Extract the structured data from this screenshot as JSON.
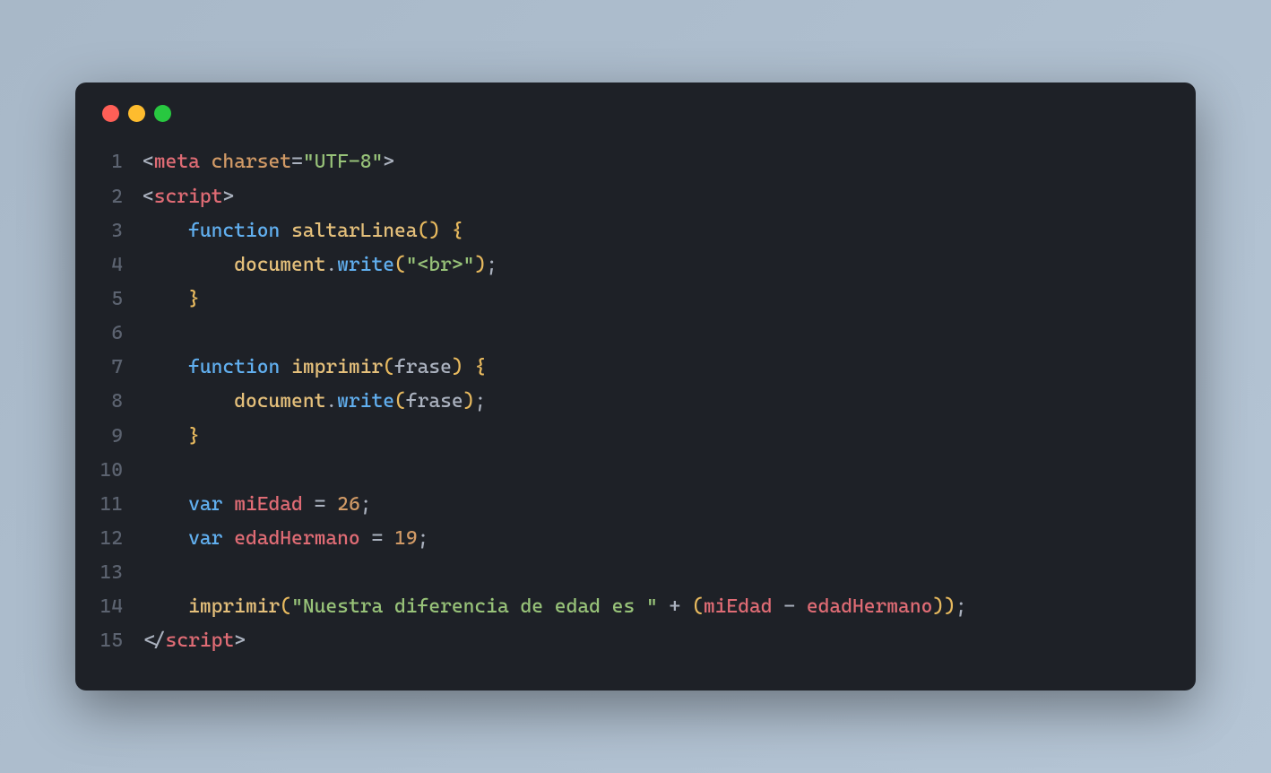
{
  "window": {
    "controls": [
      "close",
      "minimize",
      "maximize"
    ]
  },
  "code": {
    "lines": [
      {
        "num": "1",
        "indent": "",
        "tokens": [
          {
            "cls": "punct",
            "t": "<"
          },
          {
            "cls": "tag",
            "t": "meta"
          },
          {
            "cls": "default",
            "t": " "
          },
          {
            "cls": "attr",
            "t": "charset"
          },
          {
            "cls": "punct",
            "t": "="
          },
          {
            "cls": "string",
            "t": "\"UTF-8\""
          },
          {
            "cls": "punct",
            "t": ">"
          }
        ]
      },
      {
        "num": "2",
        "indent": "",
        "tokens": [
          {
            "cls": "punct",
            "t": "<"
          },
          {
            "cls": "tag",
            "t": "script"
          },
          {
            "cls": "punct",
            "t": ">"
          }
        ]
      },
      {
        "num": "3",
        "indent": "    ",
        "tokens": [
          {
            "cls": "kw-blue",
            "t": "function"
          },
          {
            "cls": "default",
            "t": " "
          },
          {
            "cls": "ident",
            "t": "saltarLinea"
          },
          {
            "cls": "bracket",
            "t": "()"
          },
          {
            "cls": "default",
            "t": " "
          },
          {
            "cls": "bracket",
            "t": "{"
          }
        ]
      },
      {
        "num": "4",
        "indent": "        ",
        "tokens": [
          {
            "cls": "obj",
            "t": "document"
          },
          {
            "cls": "punct",
            "t": "."
          },
          {
            "cls": "func",
            "t": "write"
          },
          {
            "cls": "bracket",
            "t": "("
          },
          {
            "cls": "string",
            "t": "\"<br>\""
          },
          {
            "cls": "bracket",
            "t": ")"
          },
          {
            "cls": "punct",
            "t": ";"
          }
        ]
      },
      {
        "num": "5",
        "indent": "    ",
        "tokens": [
          {
            "cls": "bracket",
            "t": "}"
          }
        ]
      },
      {
        "num": "6",
        "indent": "",
        "tokens": []
      },
      {
        "num": "7",
        "indent": "    ",
        "tokens": [
          {
            "cls": "kw-blue",
            "t": "function"
          },
          {
            "cls": "default",
            "t": " "
          },
          {
            "cls": "ident",
            "t": "imprimir"
          },
          {
            "cls": "bracket",
            "t": "("
          },
          {
            "cls": "param",
            "t": "frase"
          },
          {
            "cls": "bracket",
            "t": ")"
          },
          {
            "cls": "default",
            "t": " "
          },
          {
            "cls": "bracket",
            "t": "{"
          }
        ]
      },
      {
        "num": "8",
        "indent": "        ",
        "tokens": [
          {
            "cls": "obj",
            "t": "document"
          },
          {
            "cls": "punct",
            "t": "."
          },
          {
            "cls": "func",
            "t": "write"
          },
          {
            "cls": "bracket",
            "t": "("
          },
          {
            "cls": "param",
            "t": "frase"
          },
          {
            "cls": "bracket",
            "t": ")"
          },
          {
            "cls": "punct",
            "t": ";"
          }
        ]
      },
      {
        "num": "9",
        "indent": "    ",
        "tokens": [
          {
            "cls": "bracket",
            "t": "}"
          }
        ]
      },
      {
        "num": "10",
        "indent": "",
        "tokens": []
      },
      {
        "num": "11",
        "indent": "    ",
        "tokens": [
          {
            "cls": "kw-blue",
            "t": "var"
          },
          {
            "cls": "default",
            "t": " "
          },
          {
            "cls": "var-name",
            "t": "miEdad"
          },
          {
            "cls": "default",
            "t": " "
          },
          {
            "cls": "punct",
            "t": "="
          },
          {
            "cls": "default",
            "t": " "
          },
          {
            "cls": "number",
            "t": "26"
          },
          {
            "cls": "punct",
            "t": ";"
          }
        ]
      },
      {
        "num": "12",
        "indent": "    ",
        "tokens": [
          {
            "cls": "kw-blue",
            "t": "var"
          },
          {
            "cls": "default",
            "t": " "
          },
          {
            "cls": "var-name",
            "t": "edadHermano"
          },
          {
            "cls": "default",
            "t": " "
          },
          {
            "cls": "punct",
            "t": "="
          },
          {
            "cls": "default",
            "t": " "
          },
          {
            "cls": "number",
            "t": "19"
          },
          {
            "cls": "punct",
            "t": ";"
          }
        ]
      },
      {
        "num": "13",
        "indent": "",
        "tokens": []
      },
      {
        "num": "14",
        "indent": "    ",
        "tokens": [
          {
            "cls": "ident",
            "t": "imprimir"
          },
          {
            "cls": "bracket",
            "t": "("
          },
          {
            "cls": "string",
            "t": "\"Nuestra diferencia de edad es \""
          },
          {
            "cls": "default",
            "t": " "
          },
          {
            "cls": "punct",
            "t": "+"
          },
          {
            "cls": "default",
            "t": " "
          },
          {
            "cls": "bracket",
            "t": "("
          },
          {
            "cls": "var-name",
            "t": "miEdad"
          },
          {
            "cls": "default",
            "t": " "
          },
          {
            "cls": "punct",
            "t": "-"
          },
          {
            "cls": "default",
            "t": " "
          },
          {
            "cls": "var-name",
            "t": "edadHermano"
          },
          {
            "cls": "bracket",
            "t": "))"
          },
          {
            "cls": "punct",
            "t": ";"
          }
        ]
      },
      {
        "num": "15",
        "indent": "",
        "tokens": [
          {
            "cls": "punct",
            "t": "</"
          },
          {
            "cls": "tag",
            "t": "script"
          },
          {
            "cls": "punct",
            "t": ">"
          }
        ]
      }
    ]
  }
}
